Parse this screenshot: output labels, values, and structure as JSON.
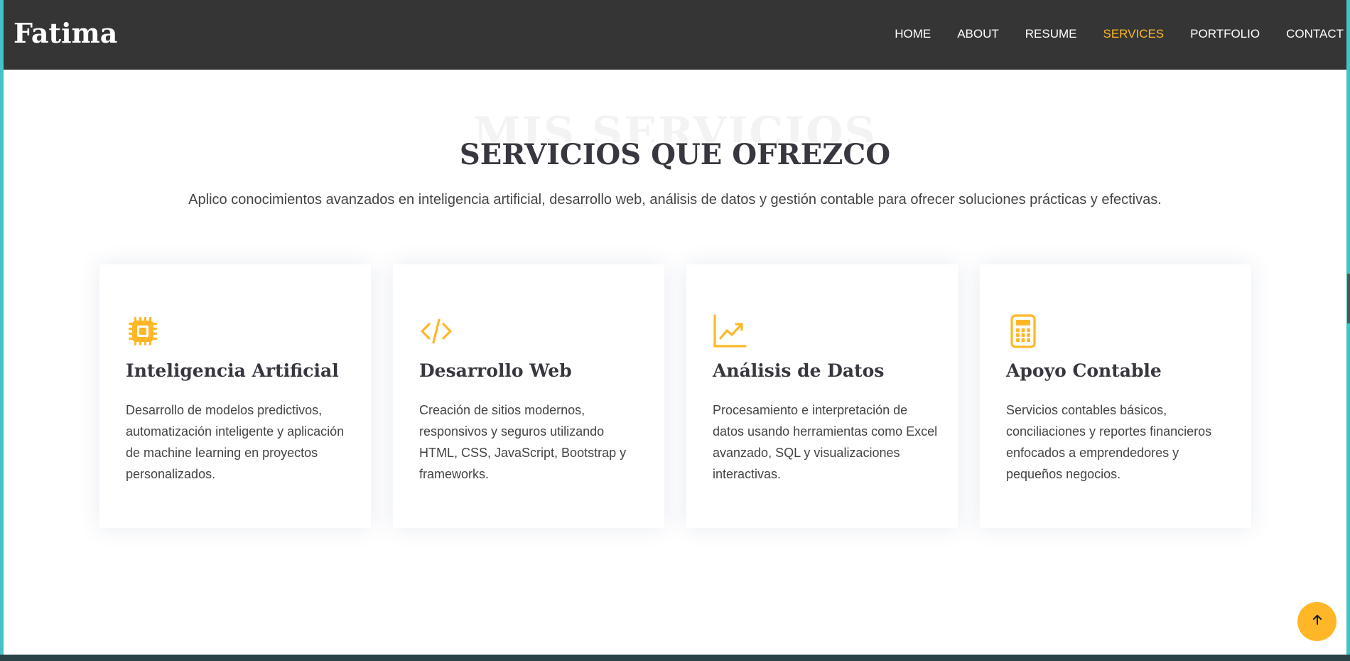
{
  "header": {
    "logo": "Fatima",
    "nav": [
      "HOME",
      "ABOUT",
      "RESUME",
      "SERVICES",
      "PORTFOLIO",
      "CONTACT"
    ],
    "active_nav": "SERVICES"
  },
  "section": {
    "background_title": "MIS SERVICIOS",
    "title": "SERVICIOS QUE OFREZCO",
    "subtitle": "Aplico conocimientos avanzados en inteligencia artificial, desarrollo web, análisis de datos y gestión contable para ofrecer soluciones prácticas y efectivas."
  },
  "services": [
    {
      "icon": "cpu-chip-icon",
      "title": "Inteligencia Artificial",
      "description": "Desarrollo de modelos predictivos, automatización inteligente y aplicación de machine learning en proyectos personalizados."
    },
    {
      "icon": "code-icon",
      "title": "Desarrollo Web",
      "description": "Creación de sitios modernos, responsivos y seguros utilizando HTML, CSS, JavaScript, Bootstrap y frameworks."
    },
    {
      "icon": "chart-line-icon",
      "title": "Análisis de Datos",
      "description": "Procesamiento e interpretación de datos usando herramientas como Excel avanzado, SQL y visualizaciones interactivas."
    },
    {
      "icon": "calculator-icon",
      "title": "Apoyo Contable",
      "description": "Servicios contables básicos, conciliaciones y reportes financieros enfocados a emprendedores y pequeños negocios."
    }
  ],
  "back_to_top_icon": "arrow-up-icon",
  "colors": {
    "accent": "#ffb727",
    "header_bg": "#353535",
    "heading": "#37373f",
    "body_text": "#444444",
    "frame": "#45c1c7"
  }
}
